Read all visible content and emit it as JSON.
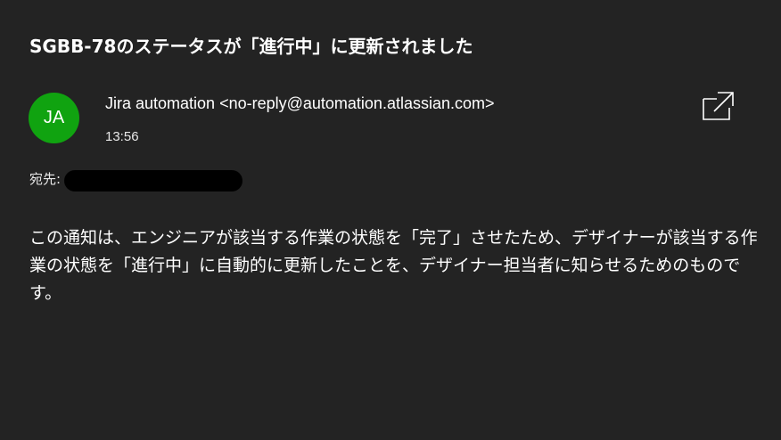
{
  "email": {
    "subject": "SGBB-78のステータスが「進行中」に更新されました",
    "sender": {
      "initials": "JA",
      "display": "Jira automation <no-reply@automation.atlassian.com>",
      "avatar_color": "#10a310"
    },
    "time": "13:56",
    "to_label": "宛先:",
    "body": "この通知は、エンジニアが該当する作業の状態を「完了」させたため、デザイナーが該当する作業の状態を「進行中」に自動的に更新したことを、デザイナー担当者に知らせるためのものです。"
  },
  "toolbar": {
    "popout_icon": "popout-window-icon"
  },
  "colors": {
    "background": "#232323",
    "text": "#ffffff"
  }
}
